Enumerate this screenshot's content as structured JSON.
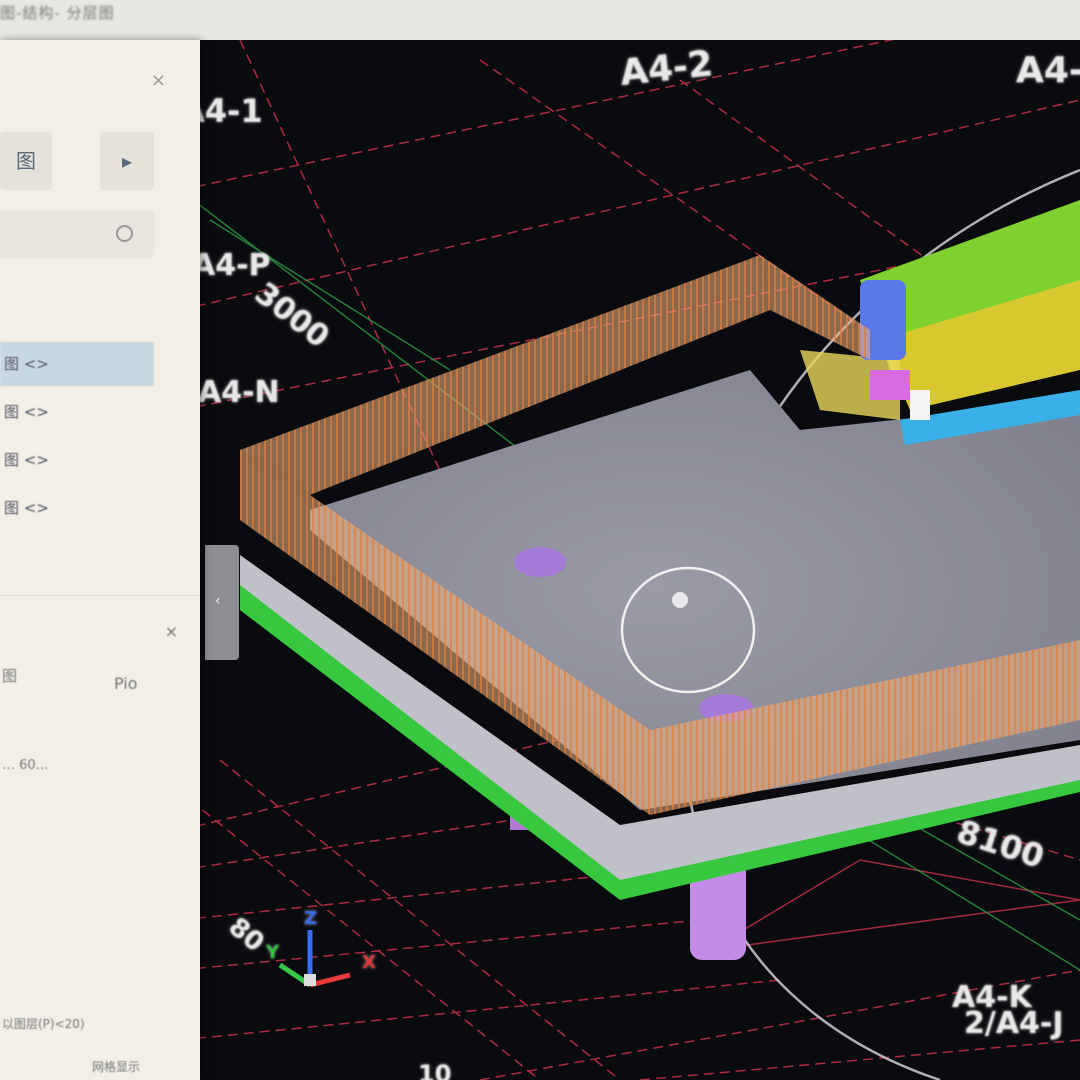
{
  "window": {
    "title": "图-结构- 分层图"
  },
  "panel": {
    "close_glyph": "×",
    "tool_left_label": "图",
    "tool_right_label": "▸",
    "list_items": [
      "图 <>",
      "图 <>",
      "图 <>",
      "图 <>"
    ],
    "section_close_glyph": "×",
    "prop_label": "图",
    "prop_value": "Pio",
    "prop_row": "… 60…",
    "footer_text": "以图层(P)<20)",
    "bottom_text": "网格显示"
  },
  "collapse_tab": {
    "glyph": "‹"
  },
  "viewport": {
    "grid_labels": {
      "a4_1": "A4-1",
      "a4_2": "A4-2",
      "a4_top_right": "A4-",
      "a4_p": "A4-P",
      "dim_3000": "3000",
      "a4_n": "A4-N",
      "dim_8100": "8100",
      "a4_k": "A4-K",
      "a4_j": "2/A4-J",
      "edge_80": "80",
      "edge_10": "10"
    },
    "axis_labels": {
      "x": "X",
      "y": "Y",
      "z": "Z"
    },
    "colors": {
      "background": "#0a0b0f",
      "grid_red": "#c8324a",
      "grid_green": "#2e9a45",
      "slab_top": "#8d8e9a",
      "slab_edge": "#bfc0c8",
      "rail": "#f0a36a",
      "column": "#c48ce6",
      "beam_green": "#7ed12f",
      "beam_yellow": "#d8c830",
      "beam_blue": "#5a78e8",
      "base_green": "#38c840"
    }
  }
}
